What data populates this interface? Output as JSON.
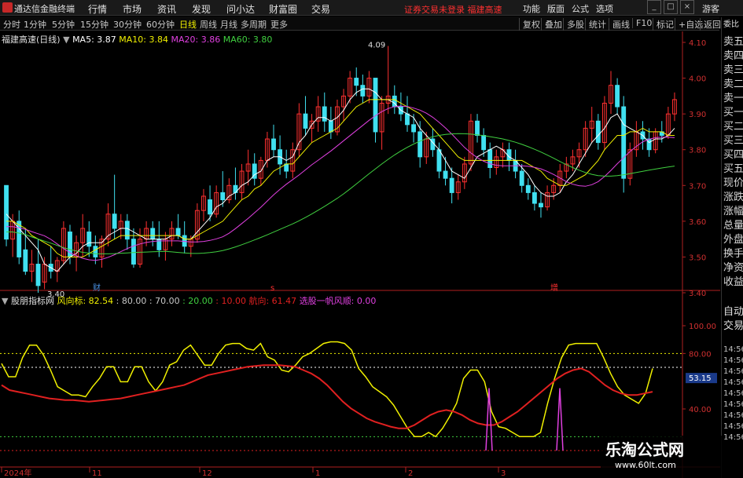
{
  "app": {
    "title": "通达信金融终端"
  },
  "menu": [
    "行情",
    "市场",
    "资讯",
    "发现",
    "问小达",
    "财富圈",
    "交易"
  ],
  "warning": "证券交易未登录  福建高速",
  "sys_menu": [
    "功能",
    "版面",
    "公式",
    "选项"
  ],
  "guest": "游客",
  "periods": [
    "分时",
    "1分钟",
    "5分钟",
    "15分钟",
    "30分钟",
    "60分钟",
    "日线",
    "周线",
    "月线",
    "多周期",
    "更多"
  ],
  "active_period": "日线",
  "right_tools": [
    "复权",
    "叠加",
    "多股",
    "统计",
    "画线",
    "F10",
    "标记",
    "+自选",
    "返回"
  ],
  "stock": {
    "name": "福建高速(日线)"
  },
  "ma": [
    {
      "label": "MA5: 3.87",
      "color": "#ffffff"
    },
    {
      "label": "MA10: 3.84",
      "color": "#f0f000"
    },
    {
      "label": "MA20: 3.86",
      "color": "#e040e0"
    },
    {
      "label": "MA60: 3.80",
      "color": "#40d040"
    }
  ],
  "price_axis": [
    "4.10",
    "4.00",
    "3.90",
    "3.80",
    "3.70",
    "3.60",
    "3.50",
    "3.40"
  ],
  "high_label": "4.09",
  "low_label": "3.40",
  "event_markers": [
    "财",
    "s",
    "增"
  ],
  "indicator": {
    "name": "股朋指标网",
    "parts": [
      {
        "text": "风向标: 82.54",
        "color": "#f0f000"
      },
      {
        "text": ": 80.00",
        "color": "#c8c8c8"
      },
      {
        "text": ": 70.00",
        "color": "#c8c8c8"
      },
      {
        "text": ": 20.00",
        "color": "#40d040"
      },
      {
        "text": ": 10.00",
        "color": "#e02020"
      },
      {
        "text": "航向: 61.47",
        "color": "#e02020"
      },
      {
        "text": "选股一帆风顺: 0.00",
        "color": "#e040e0"
      }
    ]
  },
  "ind_axis": [
    "100.00",
    "80.00",
    "53.15",
    "40.00"
  ],
  "current_value": "53.15",
  "date_axis": [
    "2024年",
    "11",
    "12",
    "1",
    "2",
    "3"
  ],
  "sidebar": {
    "top": "委比",
    "items": [
      "卖五",
      "卖四",
      "卖三",
      "卖二",
      "卖一",
      "买一",
      "买二",
      "买三",
      "买四",
      "买五",
      "现价",
      "涨跌",
      "涨幅",
      "总量",
      "外盘",
      "换手",
      "净资",
      "收益"
    ],
    "auto_trade": [
      "自动",
      "交易"
    ],
    "times": [
      "14:56",
      "14:56",
      "14:56",
      "14:56",
      "14:56",
      "14:56",
      "14:56",
      "14:56",
      "14:56"
    ]
  },
  "watermark": {
    "title": "乐淘公式网",
    "url": "www.60lt.com"
  },
  "colors": {
    "up": "#ff3030",
    "down": "#40e0f0",
    "ma5": "#ffffff",
    "ma10": "#f0f000",
    "ma20": "#e040e0",
    "ma60": "#40d040"
  },
  "chart_data": {
    "type": "candlestick",
    "ohlc": [
      [
        3.7,
        3.68,
        3.53,
        3.55
      ],
      [
        3.55,
        3.62,
        3.5,
        3.6
      ],
      [
        3.6,
        3.63,
        3.48,
        3.5
      ],
      [
        3.52,
        3.58,
        3.45,
        3.46
      ],
      [
        3.46,
        3.52,
        3.43,
        3.48
      ],
      [
        3.48,
        3.55,
        3.4,
        3.42
      ],
      [
        3.43,
        3.5,
        3.41,
        3.48
      ],
      [
        3.48,
        3.53,
        3.44,
        3.46
      ],
      [
        3.46,
        3.5,
        3.43,
        3.49
      ],
      [
        3.49,
        3.6,
        3.48,
        3.58
      ],
      [
        3.57,
        3.59,
        3.48,
        3.5
      ],
      [
        3.5,
        3.56,
        3.46,
        3.54
      ],
      [
        3.54,
        3.62,
        3.5,
        3.58
      ],
      [
        3.57,
        3.6,
        3.5,
        3.53
      ],
      [
        3.53,
        3.56,
        3.48,
        3.5
      ],
      [
        3.5,
        3.56,
        3.47,
        3.55
      ],
      [
        3.55,
        3.65,
        3.53,
        3.62
      ],
      [
        3.62,
        3.73,
        3.55,
        3.58
      ],
      [
        3.58,
        3.62,
        3.55,
        3.6
      ],
      [
        3.6,
        3.62,
        3.52,
        3.55
      ],
      [
        3.55,
        3.58,
        3.47,
        3.48
      ],
      [
        3.48,
        3.58,
        3.47,
        3.55
      ],
      [
        3.55,
        3.6,
        3.53,
        3.58
      ],
      [
        3.58,
        3.6,
        3.53,
        3.55
      ],
      [
        3.55,
        3.6,
        3.5,
        3.52
      ],
      [
        3.52,
        3.57,
        3.49,
        3.55
      ],
      [
        3.55,
        3.6,
        3.53,
        3.58
      ],
      [
        3.58,
        3.62,
        3.55,
        3.56
      ],
      [
        3.56,
        3.6,
        3.51,
        3.53
      ],
      [
        3.53,
        3.56,
        3.5,
        3.55
      ],
      [
        3.55,
        3.65,
        3.54,
        3.63
      ],
      [
        3.63,
        3.69,
        3.6,
        3.67
      ],
      [
        3.66,
        3.7,
        3.6,
        3.62
      ],
      [
        3.62,
        3.7,
        3.61,
        3.68
      ],
      [
        3.68,
        3.74,
        3.64,
        3.66
      ],
      [
        3.66,
        3.72,
        3.65,
        3.7
      ],
      [
        3.7,
        3.75,
        3.66,
        3.68
      ],
      [
        3.68,
        3.76,
        3.66,
        3.74
      ],
      [
        3.74,
        3.8,
        3.7,
        3.76
      ],
      [
        3.76,
        3.79,
        3.7,
        3.72
      ],
      [
        3.72,
        3.78,
        3.7,
        3.77
      ],
      [
        3.77,
        3.85,
        3.75,
        3.83
      ],
      [
        3.83,
        3.87,
        3.78,
        3.8
      ],
      [
        3.8,
        3.84,
        3.73,
        3.76
      ],
      [
        3.76,
        3.8,
        3.72,
        3.74
      ],
      [
        3.74,
        3.82,
        3.72,
        3.8
      ],
      [
        3.8,
        3.93,
        3.78,
        3.9
      ],
      [
        3.9,
        3.95,
        3.84,
        3.86
      ],
      [
        3.86,
        3.9,
        3.82,
        3.88
      ],
      [
        3.88,
        3.95,
        3.85,
        3.92
      ],
      [
        3.92,
        3.96,
        3.85,
        3.88
      ],
      [
        3.88,
        3.92,
        3.83,
        3.85
      ],
      [
        3.85,
        3.94,
        3.84,
        3.92
      ],
      [
        3.92,
        3.97,
        3.88,
        3.95
      ],
      [
        3.95,
        4.02,
        3.93,
        4.0
      ],
      [
        4.0,
        4.03,
        3.95,
        3.98
      ],
      [
        3.98,
        4.01,
        3.93,
        3.95
      ],
      [
        3.95,
        4.02,
        3.93,
        4.0
      ],
      [
        4.0,
        4.0,
        3.82,
        3.85
      ],
      [
        3.85,
        3.95,
        3.8,
        3.93
      ],
      [
        3.93,
        4.09,
        3.9,
        3.95
      ],
      [
        3.95,
        3.98,
        3.9,
        3.92
      ],
      [
        3.92,
        3.96,
        3.88,
        3.9
      ],
      [
        3.9,
        3.95,
        3.85,
        3.87
      ],
      [
        3.87,
        3.9,
        3.82,
        3.85
      ],
      [
        3.85,
        3.88,
        3.75,
        3.78
      ],
      [
        3.78,
        3.85,
        3.76,
        3.83
      ],
      [
        3.83,
        3.86,
        3.78,
        3.8
      ],
      [
        3.8,
        3.82,
        3.72,
        3.74
      ],
      [
        3.74,
        3.78,
        3.7,
        3.72
      ],
      [
        3.72,
        3.75,
        3.65,
        3.68
      ],
      [
        3.68,
        3.73,
        3.66,
        3.71
      ],
      [
        3.71,
        3.78,
        3.69,
        3.76
      ],
      [
        3.76,
        3.9,
        3.74,
        3.88
      ],
      [
        3.88,
        3.9,
        3.82,
        3.84
      ],
      [
        3.84,
        3.86,
        3.78,
        3.8
      ],
      [
        3.8,
        3.82,
        3.72,
        3.75
      ],
      [
        3.75,
        3.8,
        3.73,
        3.78
      ],
      [
        3.78,
        3.82,
        3.75,
        3.8
      ],
      [
        3.8,
        3.82,
        3.74,
        3.77
      ],
      [
        3.77,
        3.8,
        3.72,
        3.74
      ],
      [
        3.74,
        3.76,
        3.68,
        3.7
      ],
      [
        3.7,
        3.72,
        3.66,
        3.68
      ],
      [
        3.68,
        3.7,
        3.63,
        3.65
      ],
      [
        3.65,
        3.68,
        3.61,
        3.64
      ],
      [
        3.64,
        3.7,
        3.63,
        3.68
      ],
      [
        3.68,
        3.72,
        3.66,
        3.7
      ],
      [
        3.7,
        3.76,
        3.68,
        3.74
      ],
      [
        3.74,
        3.78,
        3.72,
        3.76
      ],
      [
        3.76,
        3.8,
        3.74,
        3.78
      ],
      [
        3.78,
        3.82,
        3.75,
        3.8
      ],
      [
        3.8,
        3.88,
        3.78,
        3.86
      ],
      [
        3.86,
        3.92,
        3.82,
        3.88
      ],
      [
        3.88,
        3.9,
        3.8,
        3.82
      ],
      [
        3.82,
        3.95,
        3.8,
        3.93
      ],
      [
        3.93,
        4.02,
        3.9,
        3.98
      ],
      [
        3.98,
        4.0,
        3.9,
        3.92
      ],
      [
        3.92,
        3.95,
        3.68,
        3.72
      ],
      [
        3.72,
        3.82,
        3.7,
        3.8
      ],
      [
        3.8,
        3.88,
        3.78,
        3.85
      ],
      [
        3.85,
        3.88,
        3.8,
        3.83
      ],
      [
        3.83,
        3.86,
        3.78,
        3.8
      ],
      [
        3.8,
        3.86,
        3.79,
        3.85
      ],
      [
        3.85,
        3.88,
        3.82,
        3.84
      ],
      [
        3.84,
        3.92,
        3.83,
        3.9
      ],
      [
        3.9,
        3.96,
        3.88,
        3.94
      ]
    ],
    "ma5": [
      3.62,
      3.6,
      3.58,
      3.56,
      3.54,
      3.52,
      3.48,
      3.47,
      3.46,
      3.48,
      3.5,
      3.51,
      3.53,
      3.54,
      3.54,
      3.54,
      3.56,
      3.57,
      3.58,
      3.58,
      3.57,
      3.56,
      3.55,
      3.55,
      3.55,
      3.55,
      3.56,
      3.56,
      3.55,
      3.55,
      3.57,
      3.59,
      3.61,
      3.64,
      3.65,
      3.67,
      3.68,
      3.7,
      3.71,
      3.73,
      3.74,
      3.77,
      3.78,
      3.78,
      3.77,
      3.78,
      3.82,
      3.84,
      3.87,
      3.89,
      3.89,
      3.88,
      3.89,
      3.91,
      3.94,
      3.96,
      3.97,
      3.97,
      3.96,
      3.94,
      3.94,
      3.93,
      3.91,
      3.9,
      3.89,
      3.86,
      3.84,
      3.82,
      3.8,
      3.77,
      3.74,
      3.73,
      3.72,
      3.75,
      3.78,
      3.79,
      3.8,
      3.81,
      3.8,
      3.78,
      3.77,
      3.75,
      3.73,
      3.7,
      3.68,
      3.67,
      3.67,
      3.68,
      3.71,
      3.73,
      3.76,
      3.79,
      3.82,
      3.84,
      3.86,
      3.89,
      3.9,
      3.87,
      3.86,
      3.85,
      3.84,
      3.82,
      3.83,
      3.83,
      3.84,
      3.86
    ],
    "ma10": [
      3.6,
      3.6,
      3.59,
      3.58,
      3.56,
      3.55,
      3.54,
      3.53,
      3.51,
      3.5,
      3.5,
      3.5,
      3.5,
      3.51,
      3.52,
      3.53,
      3.54,
      3.55,
      3.56,
      3.56,
      3.56,
      3.56,
      3.56,
      3.56,
      3.56,
      3.56,
      3.56,
      3.56,
      3.55,
      3.55,
      3.56,
      3.57,
      3.58,
      3.59,
      3.6,
      3.62,
      3.64,
      3.66,
      3.67,
      3.69,
      3.7,
      3.72,
      3.74,
      3.75,
      3.76,
      3.76,
      3.78,
      3.8,
      3.82,
      3.83,
      3.84,
      3.85,
      3.86,
      3.88,
      3.9,
      3.92,
      3.93,
      3.94,
      3.94,
      3.94,
      3.94,
      3.94,
      3.93,
      3.92,
      3.91,
      3.9,
      3.88,
      3.86,
      3.84,
      3.82,
      3.8,
      3.78,
      3.77,
      3.77,
      3.77,
      3.77,
      3.77,
      3.77,
      3.77,
      3.77,
      3.77,
      3.77,
      3.76,
      3.75,
      3.74,
      3.72,
      3.71,
      3.7,
      3.7,
      3.71,
      3.72,
      3.73,
      3.75,
      3.77,
      3.8,
      3.82,
      3.84,
      3.84,
      3.85,
      3.85,
      3.86,
      3.85,
      3.85,
      3.85,
      3.84,
      3.84
    ]
  }
}
